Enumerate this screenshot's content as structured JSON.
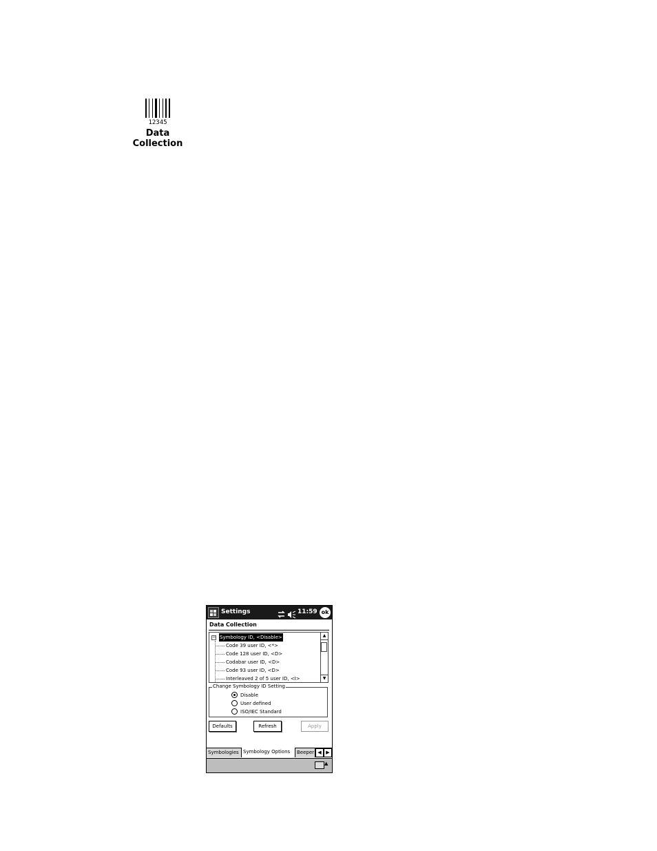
{
  "desktop_icon": {
    "label_line1": "Data",
    "label_line2": "Collection",
    "barcode_digits": "12345",
    "icon": "barcode-icon"
  },
  "window": {
    "title": "Settings",
    "clock": "11:59",
    "ok_label": "ok",
    "icons": [
      "windows-start-icon",
      "connectivity-icon",
      "speaker-icon"
    ]
  },
  "page": {
    "heading": "Data Collection"
  },
  "tree": {
    "root": "Symbology ID, <Disable>",
    "children": [
      "Code 39 user ID, <*>",
      "Code 128 user ID, <D>",
      "Codabar user ID, <D>",
      "Code 93 user ID, <D>",
      "Interleaved 2 of 5 user ID, <I>"
    ]
  },
  "group": {
    "legend": "Change Symbology ID Setting",
    "options": [
      {
        "label": "Disable",
        "selected": true
      },
      {
        "label": "User defined",
        "selected": false
      },
      {
        "label": "ISO/IEC Standard",
        "selected": false
      }
    ]
  },
  "buttons": {
    "defaults": "Defaults",
    "refresh": "Refresh",
    "apply": "Apply"
  },
  "tabs": [
    "Symbologies",
    "Symbology Options",
    "Beeper"
  ],
  "colors": {
    "titlebar": "#1a1a1a",
    "menubar": "#bdbdbd"
  }
}
